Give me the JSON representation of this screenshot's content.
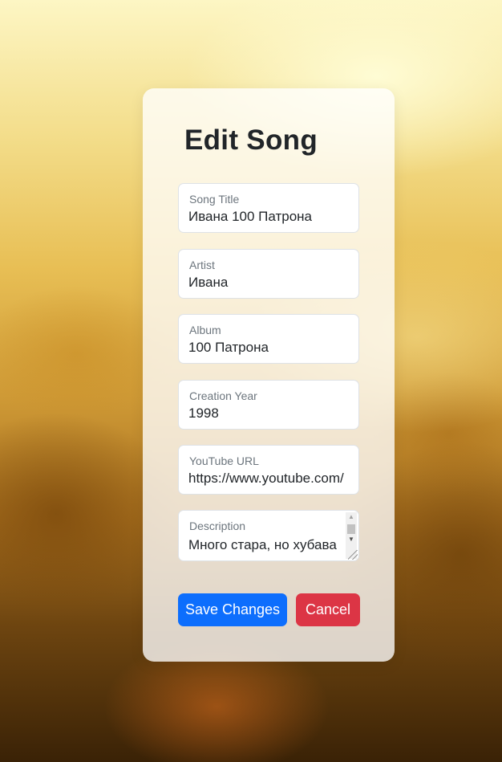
{
  "form": {
    "title": "Edit Song",
    "fields": [
      {
        "label": "Song Title",
        "value": "Ивана 100 Патрона"
      },
      {
        "label": "Artist",
        "value": "Ивана"
      },
      {
        "label": "Album",
        "value": "100 Патрона"
      },
      {
        "label": "Creation Year",
        "value": "1998"
      },
      {
        "label": "YouTube URL",
        "value": "https://www.youtube.com/"
      },
      {
        "label": "Description",
        "value": "Много стара, но хубава песен"
      }
    ],
    "save_label": "Save Changes",
    "cancel_label": "Cancel"
  },
  "colors": {
    "primary": "#0d6efd",
    "danger": "#dc3545",
    "text": "#212529",
    "label": "#6c757d"
  }
}
